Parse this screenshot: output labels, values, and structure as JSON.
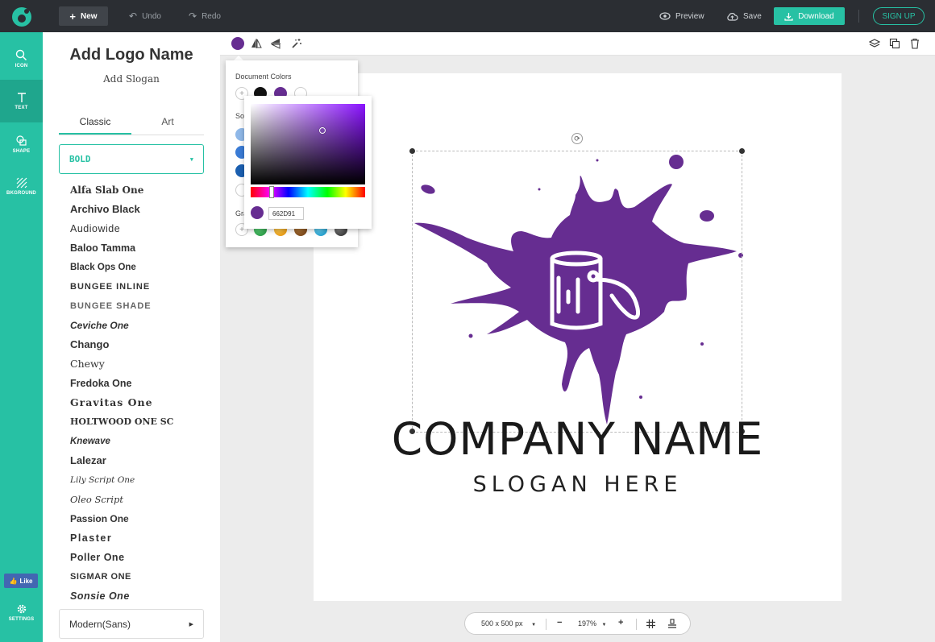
{
  "topbar": {
    "new_label": "New",
    "undo_label": "Undo",
    "redo_label": "Redo",
    "preview_label": "Preview",
    "save_label": "Save",
    "download_label": "Download",
    "signup_label": "SIGN UP"
  },
  "sidebar": {
    "items": [
      {
        "label": "ICON",
        "icon": "search-icon"
      },
      {
        "label": "TEXT",
        "icon": "text-icon"
      },
      {
        "label": "SHAPE",
        "icon": "shape-icon"
      },
      {
        "label": "BKGROUND",
        "icon": "background-icon"
      }
    ],
    "like_label": "Like",
    "settings_label": "SETTINGS"
  },
  "panel": {
    "title": "Add Logo Name",
    "slogan": "Add Slogan",
    "tabs": [
      "Classic",
      "Art"
    ],
    "selected_category": "BOLD",
    "fonts": [
      "Alfa Slab One",
      "Archivo Black",
      "Audiowide",
      "Baloo Tamma",
      "Black Ops One",
      "BUNGEE INLINE",
      "BUNGEE SHADE",
      "Ceviche One",
      "Chango",
      "Chewy",
      "Fredoka One",
      "Gravitas One",
      "HOLTWOOD ONE SC",
      "Knewave",
      "Lalezar",
      "Lily Script One",
      "Oleo Script",
      "Passion One",
      "Plaster",
      "Poller One",
      "SIGMAR ONE",
      "Sonsie One"
    ],
    "other_category": "Modern(Sans)"
  },
  "color_panel": {
    "document_colors_label": "Document Colors",
    "solid_label": "So",
    "gradient_label": "Gra",
    "hex_value": "662D91"
  },
  "canvas": {
    "company_name": "COMPANY NAME",
    "slogan": "SLOGAN HERE"
  },
  "zoom_bar": {
    "size": "500 x 500 px",
    "zoom": "197%"
  },
  "colors": {
    "accent": "#27c1a4",
    "logo_purple": "#662D91",
    "topbar": "#2b2e33"
  }
}
